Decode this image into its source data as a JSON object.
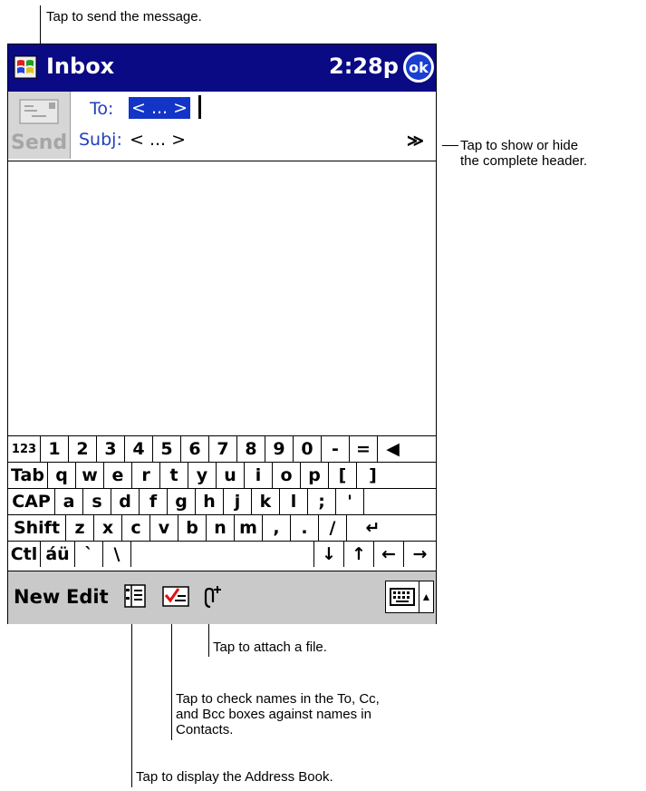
{
  "callouts": {
    "send": "Tap to send the message.",
    "header_toggle_line1": "Tap to show or hide",
    "header_toggle_line2": "the complete header.",
    "attach": "Tap to attach a file.",
    "check_names_line1": "Tap to check names in the To, Cc,",
    "check_names_line2": "and Bcc boxes against names in",
    "check_names_line3": "Contacts.",
    "address_book": "Tap to display the Address Book."
  },
  "titlebar": {
    "title": "Inbox",
    "time": "2:28p",
    "ok_label": "ok"
  },
  "header": {
    "send_label": "Send",
    "to_label": "To:",
    "to_value": "< ... >",
    "subj_label": "Subj:",
    "subj_value": "< ... >",
    "toggle_glyph": "≫"
  },
  "keyboard": {
    "rows": [
      [
        "123",
        "1",
        "2",
        "3",
        "4",
        "5",
        "6",
        "7",
        "8",
        "9",
        "0",
        "-",
        "=",
        "◀"
      ],
      [
        "Tab",
        "q",
        "w",
        "e",
        "r",
        "t",
        "y",
        "u",
        "i",
        "o",
        "p",
        "[",
        "]"
      ],
      [
        "CAP",
        "a",
        "s",
        "d",
        "f",
        "g",
        "h",
        "j",
        "k",
        "l",
        ";",
        "'"
      ],
      [
        "Shift",
        "z",
        "x",
        "c",
        "v",
        "b",
        "n",
        "m",
        ",",
        ".",
        "/",
        "↵"
      ],
      [
        "Ctl",
        "áü",
        "`",
        "\\",
        "",
        "↓",
        "↑",
        "←",
        "→"
      ]
    ]
  },
  "menubar": {
    "new_label": "New",
    "edit_label": "Edit",
    "sip_arrow": "▲"
  },
  "icons": {
    "app": "windows-flag-icon",
    "send": "envelope-icon",
    "address_book": "address-book-icon",
    "check_names": "check-names-icon",
    "attach": "paperclip-icon",
    "keyboard": "keyboard-icon"
  },
  "colors": {
    "titlebar": "#0a0a84",
    "field_label": "#2040c0",
    "selection": "#1235c8",
    "command_bar": "#c9c9c9"
  }
}
